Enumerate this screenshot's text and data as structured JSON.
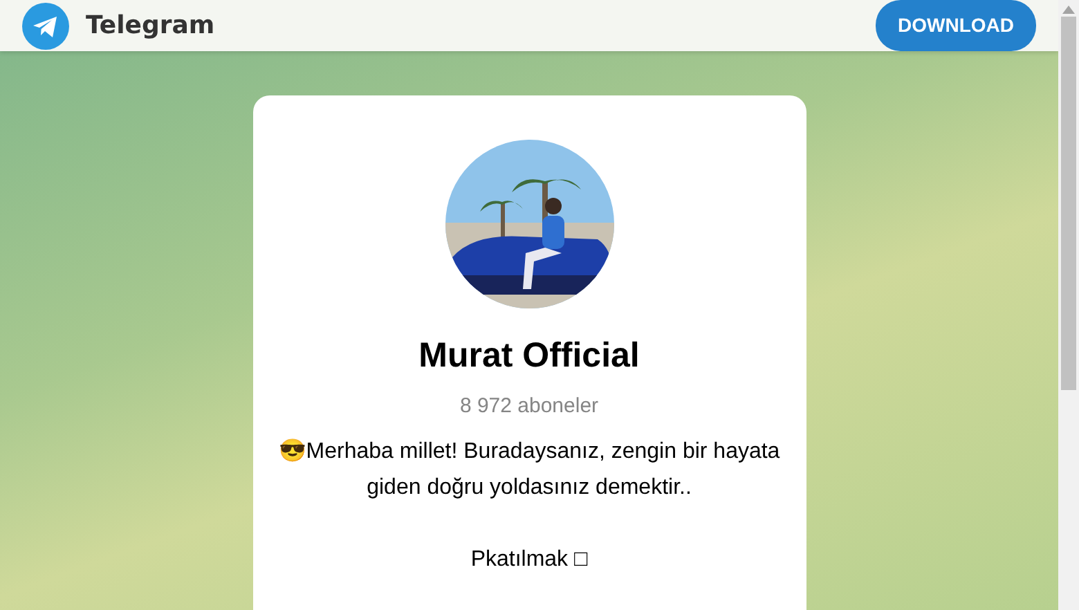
{
  "header": {
    "brand": "Telegram",
    "download_button": "DOWNLOAD"
  },
  "channel": {
    "title": "Murat Official",
    "subscribers": "8 972 aboneler",
    "description": [
      "😎Merhaba millet! Buradaysanız, zengin bir hayata giden doğru yoldasınız demektir..",
      "Pkatılmak □"
    ]
  }
}
